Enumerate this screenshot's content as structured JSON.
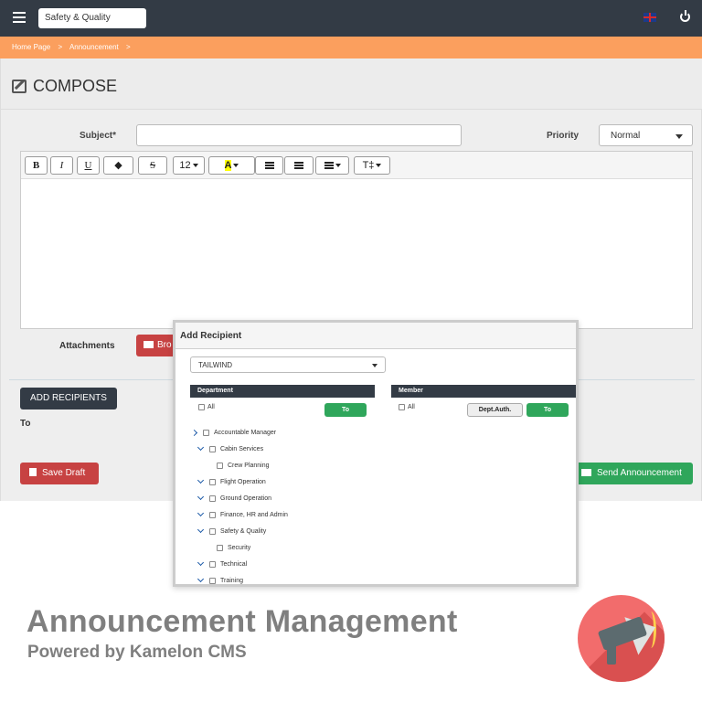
{
  "app": {
    "company": "Safety & Quality",
    "breadcrumbs": [
      "Home Page",
      ">",
      "Announcement",
      ">"
    ]
  },
  "compose": {
    "title": "COMPOSE",
    "subject_label": "Subject*",
    "subject_value": "",
    "priority_label": "Priority",
    "priority_value": "Normal",
    "toolbar": {
      "bold": "B",
      "italic": "I",
      "underline": "U",
      "strike": "S",
      "font_size": "12",
      "highlight": "A",
      "text": "T‡"
    },
    "attachments_label": "Attachments",
    "browse_label": "Bro",
    "add_recipients": "ADD RECIPIENTS",
    "to_label": "To",
    "save_draft": "Save Draft",
    "send": "Send Announcement"
  },
  "modal": {
    "title": "Add Recipient",
    "company": "TAILWIND",
    "department_header": "Department",
    "member_header": "Member",
    "all_label": "All",
    "to_button": "To",
    "dept_auth_button": "Dept.Auth.",
    "departments": [
      {
        "label": "Accountable Manager",
        "expand": "right",
        "level": 0
      },
      {
        "label": "Cabin Services",
        "expand": "down",
        "level": 1
      },
      {
        "label": "Crew Planning",
        "expand": "",
        "level": 2
      },
      {
        "label": "Flight Operation",
        "expand": "down",
        "level": 1
      },
      {
        "label": "Ground Operation",
        "expand": "down",
        "level": 1
      },
      {
        "label": "Finance, HR and Admin",
        "expand": "down",
        "level": 1
      },
      {
        "label": "Safety & Quality",
        "expand": "down",
        "level": 1
      },
      {
        "label": "Security",
        "expand": "",
        "level": 2
      },
      {
        "label": "Technical",
        "expand": "down",
        "level": 1
      },
      {
        "label": "Training",
        "expand": "down",
        "level": 1
      }
    ]
  },
  "footer": {
    "title": "Announcement Management",
    "subtitle": "Powered by Kamelon CMS"
  },
  "colors": {
    "topbar": "#333b45",
    "breadcrumb": "#fb9f5e",
    "red": "#c74242",
    "green": "#2fa65b",
    "megaphone": "#f26c6c"
  }
}
